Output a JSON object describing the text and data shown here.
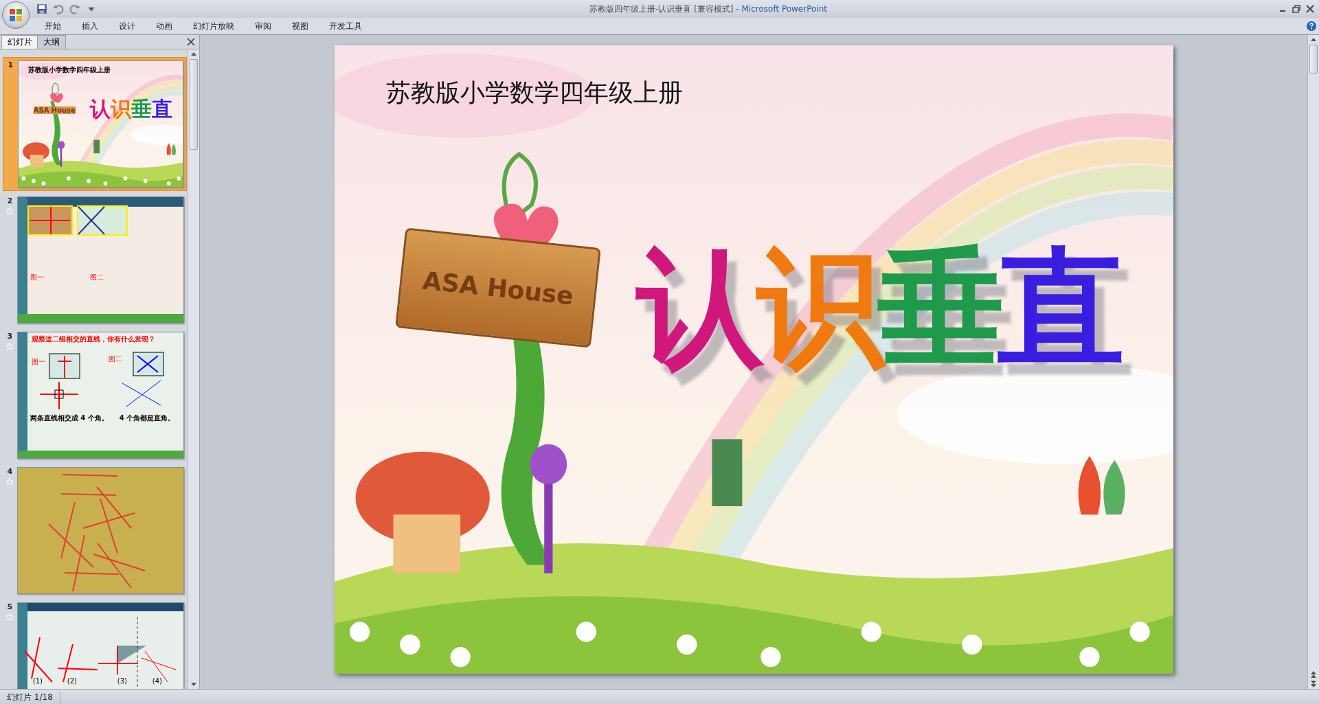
{
  "window": {
    "title": "苏教版四年级上册-认识垂直 [兼容模式] - ",
    "app_name": "Microsoft PowerPoint"
  },
  "ribbon_tabs": [
    {
      "label": "开始"
    },
    {
      "label": "插入"
    },
    {
      "label": "设计"
    },
    {
      "label": "动画"
    },
    {
      "label": "幻灯片放映"
    },
    {
      "label": "审阅"
    },
    {
      "label": "视图"
    },
    {
      "label": "开发工具"
    }
  ],
  "panel_tabs": [
    {
      "label": "幻灯片",
      "selected": true
    },
    {
      "label": "大纲",
      "selected": false
    }
  ],
  "thumbnails": [
    {
      "number": "1",
      "kind": "title",
      "selected": true,
      "animated": false,
      "heading": "苏教版小学数学四年级上册",
      "title": "认识垂直",
      "sign": "ASA House"
    },
    {
      "number": "2",
      "kind": "figures",
      "selected": false,
      "animated": true,
      "labels": [
        "图一",
        "图二"
      ]
    },
    {
      "number": "3",
      "kind": "lines",
      "selected": false,
      "animated": true,
      "heading": "观察这二组相交的直线，你有什么发现？",
      "labels": [
        "图一",
        "图二"
      ],
      "captions": [
        "两条直线相交成 4 个角。",
        "4 个角都是直角。"
      ]
    },
    {
      "number": "4",
      "kind": "sticks",
      "selected": false,
      "animated": true
    },
    {
      "number": "5",
      "kind": "triangle",
      "selected": false,
      "animated": true,
      "labels": [
        "(1)",
        "(2)",
        "(3)",
        "(4)"
      ]
    }
  ],
  "slide": {
    "heading": "苏教版小学数学四年级上册",
    "title": "认识垂直",
    "sign": "ASA House"
  },
  "status_bar": {
    "slide_counter": "幻灯片 1/18"
  }
}
